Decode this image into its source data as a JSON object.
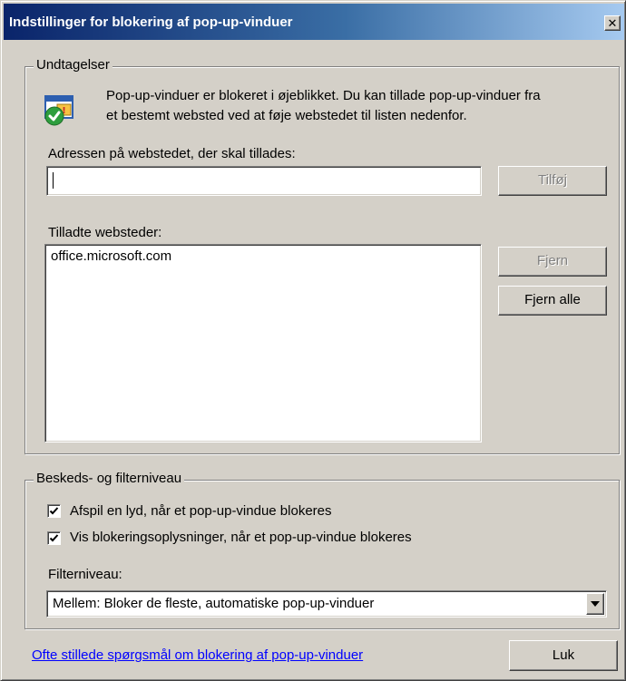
{
  "window": {
    "title": "Indstillinger for blokering af pop-up-vinduer",
    "close_glyph": "✕"
  },
  "exceptions": {
    "legend": "Undtagelser",
    "info_line1": "Pop-up-vinduer er blokeret i øjeblikket. Du kan tillade pop-up-vinduer fra",
    "info_line2": "et bestemt websted ved at føje webstedet til listen nedenfor.",
    "info_icon": "popup-shield-check-icon",
    "address_label": "Adressen på webstedet, der skal tillades:",
    "address_value": "",
    "add_button": "Tilføj",
    "allowed_label": "Tilladte websteder:",
    "allowed_sites": [
      "office.microsoft.com"
    ],
    "remove_button": "Fjern",
    "remove_all_button": "Fjern alle"
  },
  "notifications": {
    "legend": "Beskeds- og filterniveau",
    "play_sound_label": "Afspil en lyd, når et pop-up-vindue blokeres",
    "play_sound_checked": true,
    "show_info_label": "Vis blokeringsoplysninger, når et pop-up-vindue blokeres",
    "show_info_checked": true,
    "filter_label": "Filterniveau:",
    "filter_value": "Mellem: Bloker de fleste, automatiske pop-up-vinduer"
  },
  "footer": {
    "faq_link": "Ofte stillede spørgsmål om blokering af pop-up-vinduer",
    "close_button": "Luk"
  },
  "colors": {
    "dialog_face": "#d4d0c8",
    "title_start": "#0a246a",
    "title_end": "#a6caf0",
    "link": "#0000ff",
    "disabled_text": "#808080"
  }
}
